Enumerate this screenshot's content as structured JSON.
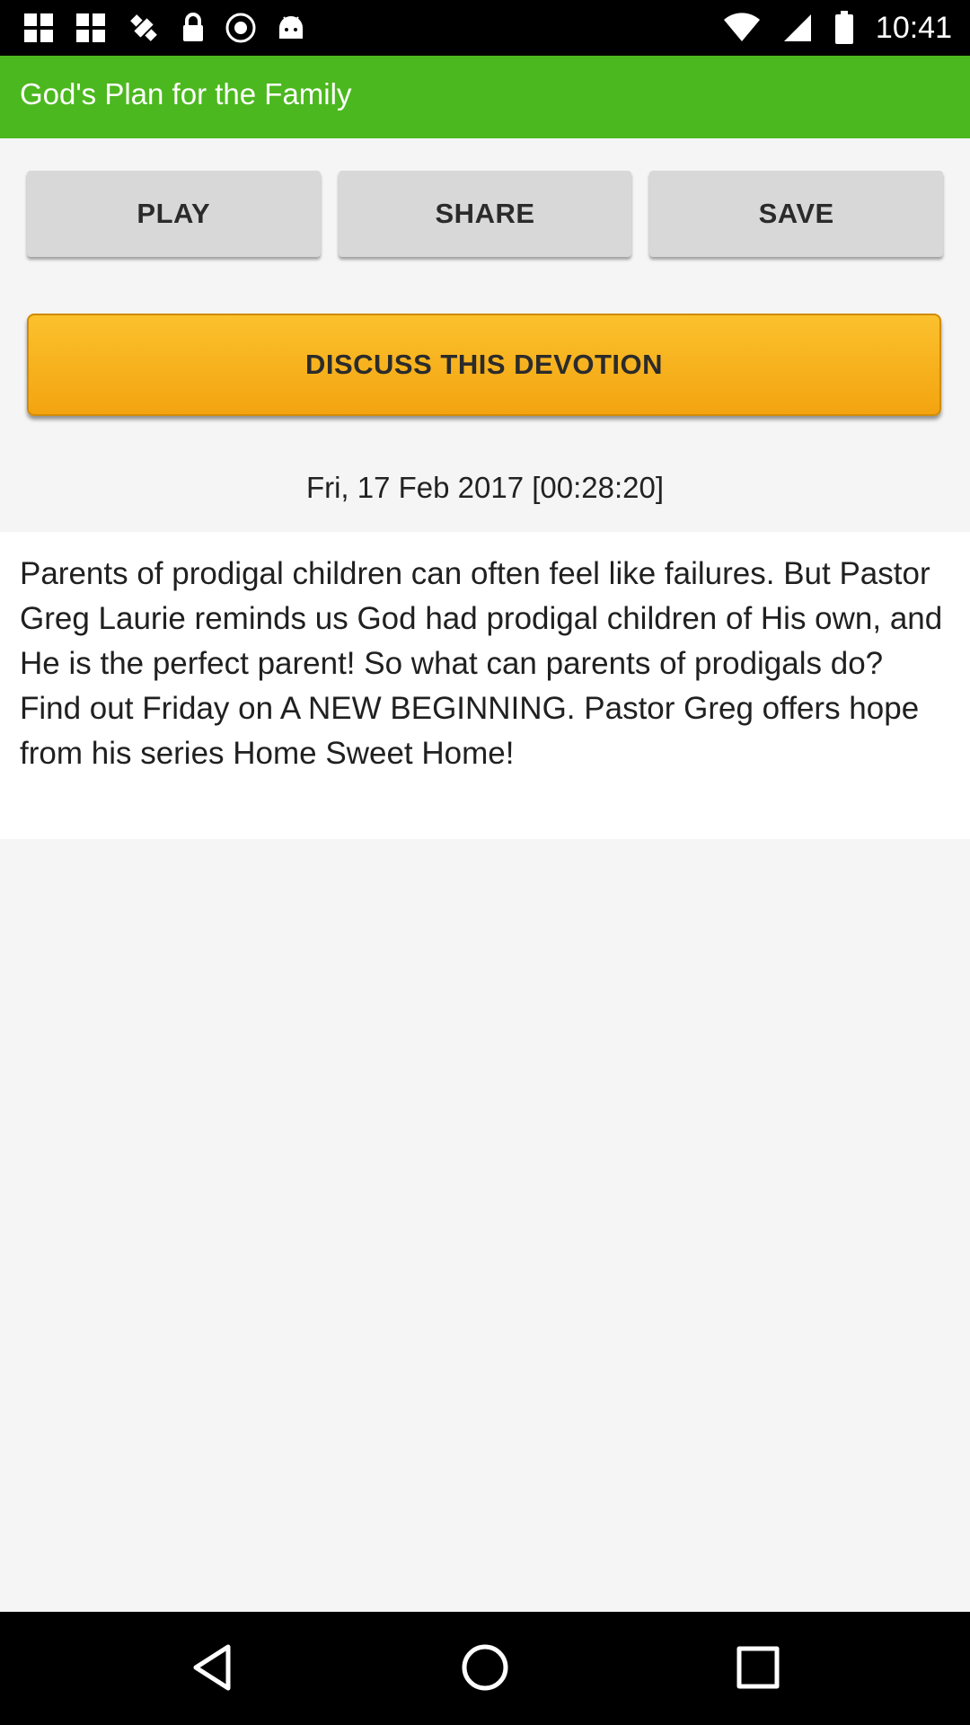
{
  "status_bar": {
    "time": "10:41",
    "left_icons": [
      "grid-icon",
      "grid-icon",
      "fake-gps-icon",
      "lock-icon",
      "record-icon",
      "android-icon"
    ],
    "right_icons": [
      "wifi-icon",
      "signal-icon",
      "battery-icon"
    ]
  },
  "app_bar": {
    "title": "God's Plan for the Family",
    "color": "#4cb81f"
  },
  "actions": {
    "play_label": "PLAY",
    "share_label": "SHARE",
    "save_label": "SAVE",
    "discuss_label": "DISCUSS THIS DEVOTION",
    "discuss_color": "#f7b21c"
  },
  "devotion": {
    "date": "Fri, 17 Feb 2017 [00:28:20]",
    "text": "Parents of prodigal children can often feel like failures. But Pastor Greg Laurie reminds us God had prodigal children of His own, and He is the perfect parent! So what can parents of prodigals do? Find out Friday on A NEW BEGINNING. Pastor Greg offers hope from his series Home Sweet Home!"
  },
  "nav_bar": {
    "icons": [
      "back-icon",
      "home-icon",
      "recents-icon"
    ]
  }
}
